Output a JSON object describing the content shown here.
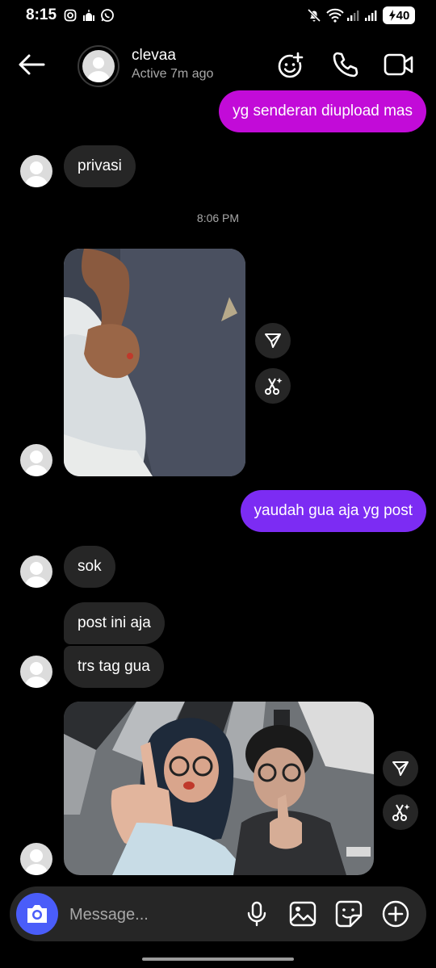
{
  "status_bar": {
    "time": "8:15",
    "battery": "40"
  },
  "header": {
    "name": "clevaa",
    "status": "Active 7m ago",
    "icons": [
      "back-arrow-icon",
      "add-emoji-icon",
      "phone-icon",
      "video-icon"
    ]
  },
  "messages": {
    "out1": "yg senderan diupload mas",
    "in1": "privasi",
    "timestamp": "8:06 PM",
    "out2": "yaudah gua aja yg post",
    "in2": "sok",
    "in3": "post ini aja",
    "in4": "trs tag gua"
  },
  "composer": {
    "placeholder": "Message...",
    "icons": [
      "camera-icon",
      "microphone-icon",
      "gallery-icon",
      "sticker-icon",
      "plus-icon"
    ]
  },
  "colors": {
    "outgoing_pink": "#c20bd8",
    "outgoing_purple": "#7c2cf3",
    "incoming": "#262626",
    "camera_blue": "#4a5df9"
  }
}
